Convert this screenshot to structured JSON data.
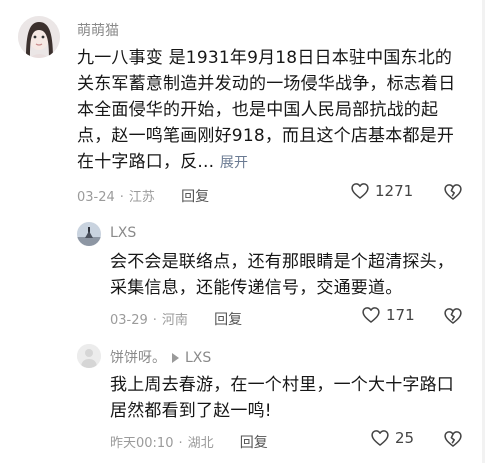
{
  "comments": [
    {
      "username": "萌萌猫",
      "text": "九一八事变 是1931年9月18日日本驻中国东北的关东军蓄意制造并发动的一场侵华战争，标志着日本全面侵华的开始，也是中国人民局部抗战的起点，赵一鸣笔画刚好918，而且这个店基本都是开在十字路口，反...",
      "expand_label": "展开",
      "date": "03-24",
      "separator": "·",
      "location": "江苏",
      "reply_label": "回复",
      "likes": "1271"
    },
    {
      "username": "LXS",
      "text": "会不会是联络点，还有那眼睛是个超清探头，采集信息，还能传递信号，交通要道。",
      "date": "03-29",
      "separator": "·",
      "location": "河南",
      "reply_label": "回复",
      "likes": "171"
    },
    {
      "username": "饼饼呀。",
      "reply_to": "LXS",
      "text": "我上周去春游，在一个村里，一个大十字路口居然都看到了赵一鸣!",
      "date": "昨天00:10",
      "separator": "·",
      "location": "湖北",
      "reply_label": "回复",
      "likes": "25"
    }
  ],
  "icons": {
    "like": "heart-outline-icon",
    "dislike": "broken-heart-icon"
  },
  "colors": {
    "meta_gray": "#9b9b9b",
    "expand_link": "#6a7a92",
    "body_text": "#161616"
  }
}
